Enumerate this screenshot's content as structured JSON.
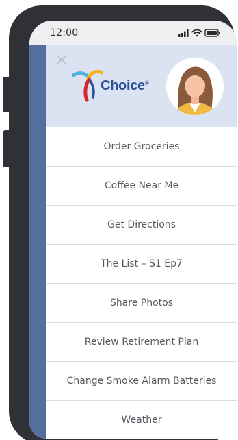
{
  "status_bar": {
    "time": "12:00",
    "icons": [
      "signal-icon",
      "wifi-icon",
      "battery-icon"
    ]
  },
  "header": {
    "close_icon": "close-icon",
    "logo_text": "Choice",
    "logo_mark": "®",
    "avatar": "user-avatar-woman"
  },
  "menu": {
    "items": [
      {
        "label": "Order Groceries"
      },
      {
        "label": "Coffee Near Me"
      },
      {
        "label": "Get Directions"
      },
      {
        "label": "The List – S1 Ep7"
      },
      {
        "label": "Share Photos"
      },
      {
        "label": "Review Retirement Plan"
      },
      {
        "label": "Change Smoke Alarm Batteries"
      },
      {
        "label": "Weather"
      }
    ]
  },
  "colors": {
    "phone_frame": "#2f3136",
    "side_strip": "#546e9e",
    "header_bg": "#dbe3f2",
    "logo_blue": "#2c4f9a",
    "logo_red": "#d8262b",
    "logo_yellow": "#f5b21b",
    "logo_light_blue": "#4fb3e0",
    "menu_text": "#555a60"
  }
}
